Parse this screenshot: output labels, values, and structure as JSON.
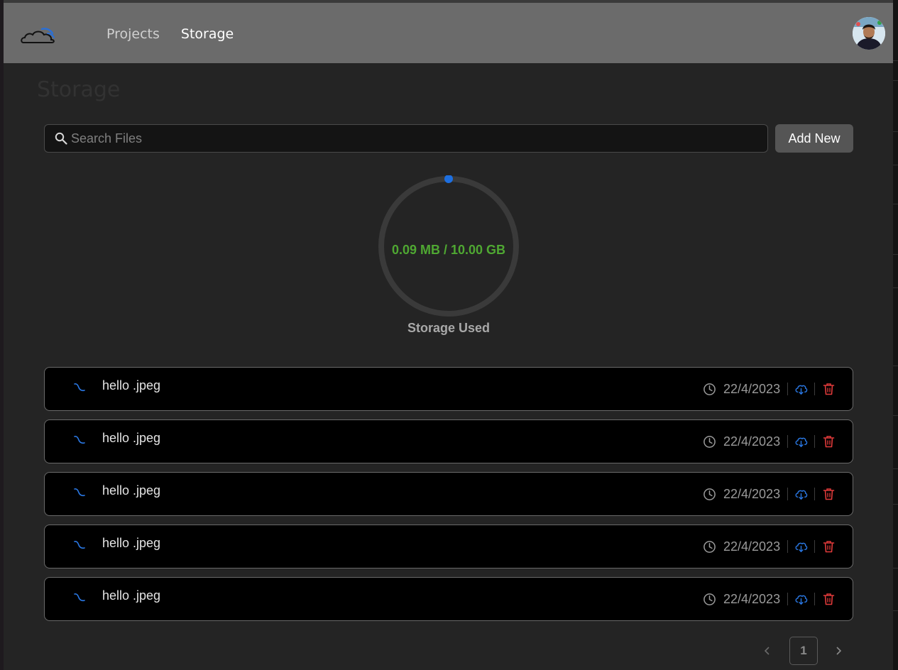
{
  "header": {
    "logo_icon": "cloud-logo-icon",
    "nav": [
      {
        "label": "Projects"
      },
      {
        "label": "Storage"
      }
    ],
    "avatar_icon": "user-avatar"
  },
  "page": {
    "title": "Storage"
  },
  "search": {
    "placeholder": "Search Files",
    "value": ""
  },
  "actions": {
    "add_new_label": "Add New"
  },
  "storage": {
    "used_text": "0.09 MB / 10.00 GB",
    "label": "Storage Used",
    "used_fraction": 9e-06,
    "ring_color": "#3a3a3a",
    "indicator_color": "#1d6fe0",
    "text_color": "#4fa832"
  },
  "files": [
    {
      "name": "hello .jpeg",
      "date": "22/4/2023",
      "icon": "file-loading-icon"
    },
    {
      "name": "hello .jpeg",
      "date": "22/4/2023",
      "icon": "file-loading-icon"
    },
    {
      "name": "hello .jpeg",
      "date": "22/4/2023",
      "icon": "file-loading-icon"
    },
    {
      "name": "hello .jpeg",
      "date": "22/4/2023",
      "icon": "file-loading-icon"
    },
    {
      "name": "hello .jpeg",
      "date": "22/4/2023",
      "icon": "file-loading-icon"
    }
  ],
  "pagination": {
    "current_page": "1",
    "prev_icon": "chevron-left-icon",
    "next_icon": "chevron-right-icon"
  },
  "colors": {
    "accent_blue": "#1d6fe0",
    "delete_red": "#e03a3a"
  }
}
